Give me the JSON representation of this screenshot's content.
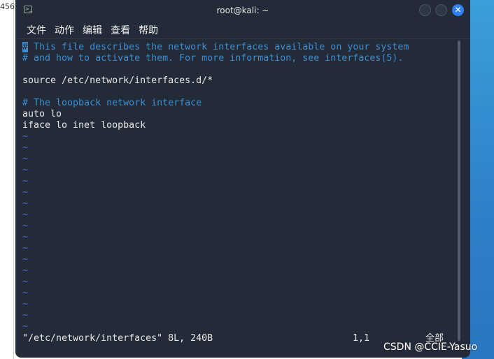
{
  "background": {
    "left_text": "456"
  },
  "window": {
    "title": "root@kali: ~",
    "accent": "#2f7ff0"
  },
  "menu": [
    "文件",
    "动作",
    "编辑",
    "查看",
    "帮助"
  ],
  "editor": {
    "lines": [
      {
        "text": "# This file describes the network interfaces available on your system",
        "type": "comment"
      },
      {
        "text": "# and how to activate them. For more information, see interfaces(5).",
        "type": "comment"
      },
      {
        "text": "",
        "type": "text"
      },
      {
        "text": "source /etc/network/interfaces.d/*",
        "type": "text"
      },
      {
        "text": "",
        "type": "text"
      },
      {
        "text": "# The loopback network interface",
        "type": "comment"
      },
      {
        "text": "auto lo",
        "type": "text"
      },
      {
        "text": "iface lo inet loopback",
        "type": "text"
      }
    ],
    "empty_marker": "~",
    "empty_count": 18
  },
  "status": {
    "file": "\"/etc/network/interfaces\" 8L, 240B",
    "position": "1,1",
    "scroll": "全部"
  },
  "watermark": "CSDN @CCIE-Yasuo"
}
